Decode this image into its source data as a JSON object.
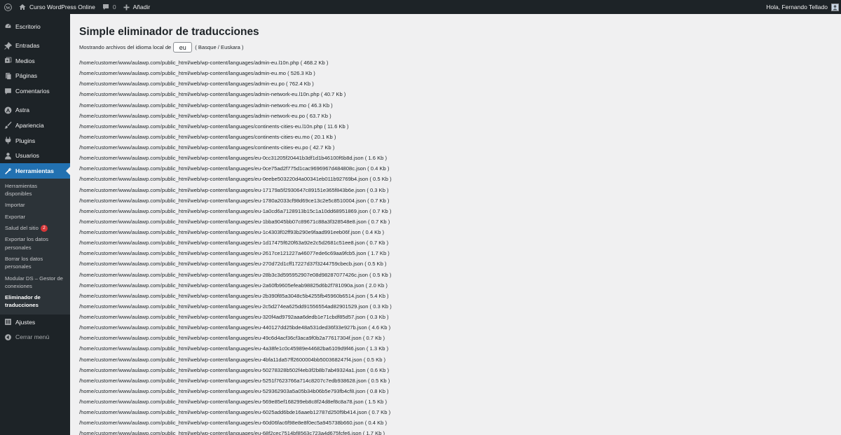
{
  "adminbar": {
    "site_name": "Curso WordPress Online",
    "comments_count": "0",
    "add_new": "Añadir",
    "greeting": "Hola, Fernando Tellado"
  },
  "sidebar": {
    "escritorio": "Escritorio",
    "entradas": "Entradas",
    "medios": "Medios",
    "paginas": "Páginas",
    "comentarios": "Comentarios",
    "astra": "Astra",
    "apariencia": "Apariencia",
    "plugins": "Plugins",
    "usuarios": "Usuarios",
    "herramientas": "Herramientas",
    "ajustes": "Ajustes",
    "cerrar": "Cerrar menú",
    "submenu": [
      {
        "label": "Herramientas disponibles"
      },
      {
        "label": "Importar"
      },
      {
        "label": "Exportar"
      },
      {
        "label": "Salud del sitio",
        "badge": "2"
      },
      {
        "label": "Exportar los datos personales"
      },
      {
        "label": "Borrar los datos personales"
      },
      {
        "label": "Modular DS – Gestor de conexiones"
      },
      {
        "label": "Eliminador de traducciones",
        "current": true
      }
    ]
  },
  "page": {
    "title": "Simple eliminador de traducciones",
    "locale_prefix": "Mostrando archivos del idioma local de",
    "locale_value": "eu",
    "locale_suffix": "( Basque / Euskara )"
  },
  "files": [
    "/home/customer/www/aulawp.com/public_html/web/wp-content/languages/admin-eu.l10n.php ( 468.2 Kb )",
    "/home/customer/www/aulawp.com/public_html/web/wp-content/languages/admin-eu.mo ( 526.3 Kb )",
    "/home/customer/www/aulawp.com/public_html/web/wp-content/languages/admin-eu.po ( 762.4 Kb )",
    "/home/customer/www/aulawp.com/public_html/web/wp-content/languages/admin-network-eu.l10n.php ( 40.7 Kb )",
    "/home/customer/www/aulawp.com/public_html/web/wp-content/languages/admin-network-eu.mo ( 46.3 Kb )",
    "/home/customer/www/aulawp.com/public_html/web/wp-content/languages/admin-network-eu.po ( 63.7 Kb )",
    "/home/customer/www/aulawp.com/public_html/web/wp-content/languages/continents-cities-eu.l10n.php ( 11.6 Kb )",
    "/home/customer/www/aulawp.com/public_html/web/wp-content/languages/continents-cities-eu.mo ( 20.1 Kb )",
    "/home/customer/www/aulawp.com/public_html/web/wp-content/languages/continents-cities-eu.po ( 42.7 Kb )",
    "/home/customer/www/aulawp.com/public_html/web/wp-content/languages/eu-0cc31205f20441b3df1d1b46100f6b8d.json ( 1.6 Kb )",
    "/home/customer/www/aulawp.com/public_html/web/wp-content/languages/eu-0ce75ad2f775d1cac9696967d484808c.json ( 0.4 Kb )",
    "/home/customer/www/aulawp.com/public_html/web/wp-content/languages/eu-0eebe503220d4a00341eb011b92769b4.json ( 0.5 Kb )",
    "/home/customer/www/aulawp.com/public_html/web/wp-content/languages/eu-17179a5f2930647c89151e365f843b6e.json ( 0.3 Kb )",
    "/home/customer/www/aulawp.com/public_html/web/wp-content/languages/eu-1780a2033cf98d69ce13c2e5c8510004.json ( 0.7 Kb )",
    "/home/customer/www/aulawp.com/public_html/web/wp-content/languages/eu-1a0cd6a7128913b15c1a10dd68951869.json ( 0.7 Kb )",
    "/home/customer/www/aulawp.com/public_html/web/wp-content/languages/eu-1bba9045bb07c89671c88a3f328548e8.json ( 0.7 Kb )",
    "/home/customer/www/aulawp.com/public_html/web/wp-content/languages/eu-1c4303f02ff93b290e9faad991eeb06f.json ( 0.4 Kb )",
    "/home/customer/www/aulawp.com/public_html/web/wp-content/languages/eu-1d17475f620f63a92e2c5d2681c51ee8.json ( 0.7 Kb )",
    "/home/customer/www/aulawp.com/public_html/web/wp-content/languages/eu-2617ce121227a46077ede6c69aa9fcb5.json ( 1.7 Kb )",
    "/home/customer/www/aulawp.com/public_html/web/wp-content/languages/eu-270d72d1cff17227d37f3244759cbecb.json ( 0.5 Kb )",
    "/home/customer/www/aulawp.com/public_html/web/wp-content/languages/eu-28b3c3d595952907e08d98287077426c.json ( 0.5 Kb )",
    "/home/customer/www/aulawp.com/public_html/web/wp-content/languages/eu-2a60fb9605efeab98825d6b2f781090a.json ( 2.0 Kb )",
    "/home/customer/www/aulawp.com/public_html/web/wp-content/languages/eu-2b390f85a3048c5b4255fb45960b6514.json ( 5.4 Kb )",
    "/home/customer/www/aulawp.com/public_html/web/wp-content/languages/eu-2c5d274ea625dd91556554ad82901529.json ( 0.3 Kb )",
    "/home/customer/www/aulawp.com/public_html/web/wp-content/languages/eu-320f4ad9792aaa6dedb1e71cbdf85d57.json ( 0.3 Kb )",
    "/home/customer/www/aulawp.com/public_html/web/wp-content/languages/eu-440127dd25bde48a531ded36f33e927b.json ( 4.6 Kb )",
    "/home/customer/www/aulawp.com/public_html/web/wp-content/languages/eu-49c6d4acf36cf3aca9f0b2a77617304f.json ( 0.7 Kb )",
    "/home/customer/www/aulawp.com/public_html/web/wp-content/languages/eu-4a38fe1c0c45989e44682ba6109d9f46.json ( 1.3 Kb )",
    "/home/customer/www/aulawp.com/public_html/web/wp-content/languages/eu-4bfa11da57ff2600004bb500368247f4.json ( 0.5 Kb )",
    "/home/customer/www/aulawp.com/public_html/web/wp-content/languages/eu-50278328b502f4eb3f2b8b7ab49324a1.json ( 0.6 Kb )",
    "/home/customer/www/aulawp.com/public_html/web/wp-content/languages/eu-5251f7623766a714c8207c7edb938628.json ( 0.5 Kb )",
    "/home/customer/www/aulawp.com/public_html/web/wp-content/languages/eu-529362903a5a05b34b06b5e793fb4cf8.json ( 0.8 Kb )",
    "/home/customer/www/aulawp.com/public_html/web/wp-content/languages/eu-569e85ef168299eb8c8f24d8ef8c8a78.json ( 1.5 Kb )",
    "/home/customer/www/aulawp.com/public_html/web/wp-content/languages/eu-6025add6bde16aaeb12787d250f9b414.json ( 0.7 Kb )",
    "/home/customer/www/aulawp.com/public_html/web/wp-content/languages/eu-60d06fac6f98e8e8f0ec5a945738b660.json ( 0.4 Kb )",
    "/home/customer/www/aulawp.com/public_html/web/wp-content/languages/eu-68f2cec7514bf8563c723a4d675fcfe6.json ( 1.7 Kb )"
  ]
}
